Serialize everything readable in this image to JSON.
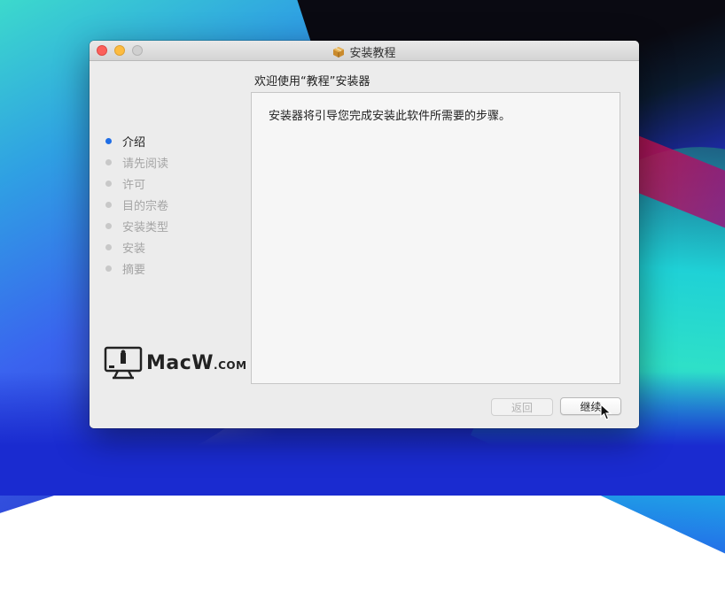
{
  "window": {
    "title": "安装教程"
  },
  "installer": {
    "heading": "欢迎使用“教程”安装器",
    "intro_text": "安装器将引导您完成安装此软件所需要的步骤。",
    "steps": [
      {
        "label": "介绍",
        "active": true
      },
      {
        "label": "请先阅读",
        "active": false
      },
      {
        "label": "许可",
        "active": false
      },
      {
        "label": "目的宗卷",
        "active": false
      },
      {
        "label": "安装类型",
        "active": false
      },
      {
        "label": "安装",
        "active": false
      },
      {
        "label": "摘要",
        "active": false
      }
    ],
    "back_button": "返回",
    "continue_button": "继续"
  },
  "branding": {
    "logo_name": "MacW",
    "logo_suffix": ".COM"
  },
  "colors": {
    "active_step": "#1f6ee6",
    "close": "#fc605b",
    "minimize": "#fdbc40"
  },
  "icons": {
    "title_icon": "package-icon",
    "cursor": "pointer-cursor-icon"
  }
}
